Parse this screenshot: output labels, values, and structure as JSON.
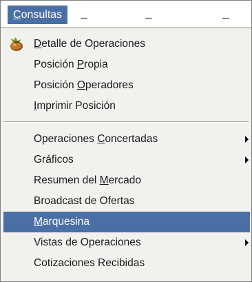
{
  "menubar": {
    "active_menu": {
      "label_first": "C",
      "label_rest": "onsultas"
    },
    "fields": [
      "_",
      "_",
      "_"
    ]
  },
  "menu": {
    "groups": [
      [
        {
          "icon": "money-bag-icon",
          "pre": "",
          "mnemonic": "D",
          "post": "etalle de Operaciones"
        },
        {
          "pre": "Posición ",
          "mnemonic": "P",
          "post": "ropia"
        },
        {
          "pre": "Posición ",
          "mnemonic": "O",
          "post": "peradores"
        },
        {
          "pre": "",
          "mnemonic": "I",
          "post": "mprimir Posición"
        }
      ],
      [
        {
          "pre": "Operaciones ",
          "mnemonic": "C",
          "post": "oncertadas",
          "submenu": true
        },
        {
          "pre": "Gr",
          "mnemonic": "á",
          "post": "ficos",
          "submenu": true
        },
        {
          "pre": "Resumen del ",
          "mnemonic": "M",
          "post": "ercado"
        },
        {
          "pre": "Broadcast de Ofertas",
          "mnemonic": "",
          "post": ""
        },
        {
          "pre": "",
          "mnemonic": "M",
          "post": "arquesina",
          "highlighted": true
        },
        {
          "pre": "Vistas de Operaciones",
          "mnemonic": "",
          "post": "",
          "submenu": true
        },
        {
          "pre": "Cotizaciones Recibidas",
          "mnemonic": "",
          "post": ""
        }
      ]
    ]
  },
  "colors": {
    "highlight": "#4a6fa5",
    "menu_background": "#f2f1ee"
  }
}
